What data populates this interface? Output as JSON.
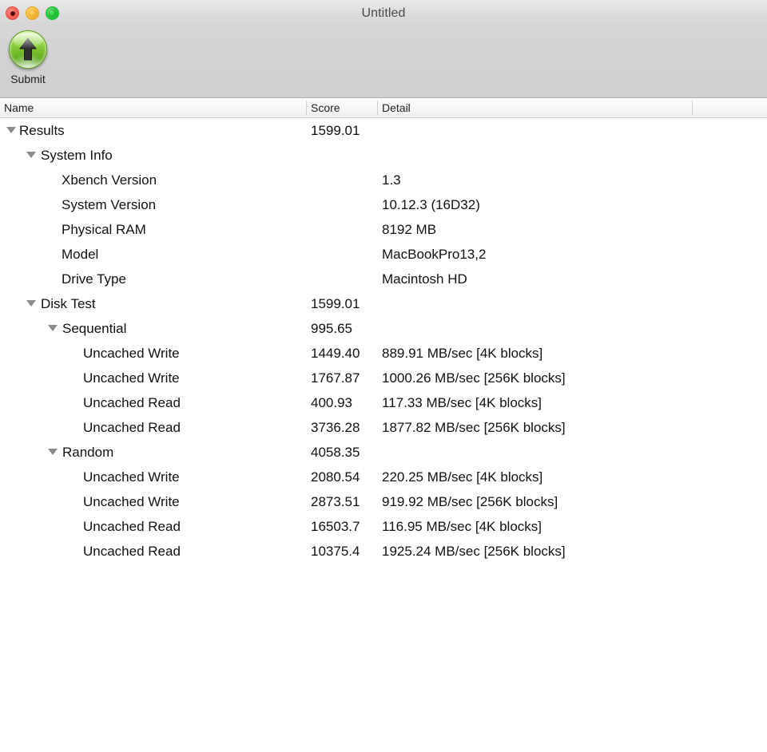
{
  "window": {
    "title": "Untitled",
    "traffic_lights": [
      "close",
      "minimize",
      "zoom"
    ]
  },
  "toolbar": {
    "submit_label": "Submit",
    "submit_icon": "green-up-arrow-orb-icon"
  },
  "columns": {
    "name": "Name",
    "score": "Score",
    "detail": "Detail"
  },
  "rows": [
    {
      "level": 0,
      "expandable": true,
      "name": "Results",
      "score": "1599.01",
      "detail": ""
    },
    {
      "level": 1,
      "expandable": true,
      "name": "System Info",
      "score": "",
      "detail": ""
    },
    {
      "level": 2,
      "expandable": false,
      "name": "Xbench Version",
      "score": "",
      "detail": "1.3"
    },
    {
      "level": 2,
      "expandable": false,
      "name": "System Version",
      "score": "",
      "detail": "10.12.3 (16D32)"
    },
    {
      "level": 2,
      "expandable": false,
      "name": "Physical RAM",
      "score": "",
      "detail": "8192 MB"
    },
    {
      "level": 2,
      "expandable": false,
      "name": "Model",
      "score": "",
      "detail": "MacBookPro13,2"
    },
    {
      "level": 2,
      "expandable": false,
      "name": "Drive Type",
      "score": "",
      "detail": "Macintosh HD"
    },
    {
      "level": 1,
      "expandable": true,
      "name": "Disk Test",
      "score": "1599.01",
      "detail": ""
    },
    {
      "level": 2,
      "expandable": true,
      "name": "Sequential",
      "score": "995.65",
      "detail": ""
    },
    {
      "level": 3,
      "expandable": false,
      "name": "Uncached Write",
      "score": "1449.40",
      "detail": "889.91 MB/sec [4K blocks]"
    },
    {
      "level": 3,
      "expandable": false,
      "name": "Uncached Write",
      "score": "1767.87",
      "detail": "1000.26 MB/sec [256K blocks]"
    },
    {
      "level": 3,
      "expandable": false,
      "name": "Uncached Read",
      "score": "400.93",
      "detail": "117.33 MB/sec [4K blocks]"
    },
    {
      "level": 3,
      "expandable": false,
      "name": "Uncached Read",
      "score": "3736.28",
      "detail": "1877.82 MB/sec [256K blocks]"
    },
    {
      "level": 2,
      "expandable": true,
      "name": "Random",
      "score": "4058.35",
      "detail": ""
    },
    {
      "level": 3,
      "expandable": false,
      "name": "Uncached Write",
      "score": "2080.54",
      "detail": "220.25 MB/sec [4K blocks]"
    },
    {
      "level": 3,
      "expandable": false,
      "name": "Uncached Write",
      "score": "2873.51",
      "detail": "919.92 MB/sec [256K blocks]"
    },
    {
      "level": 3,
      "expandable": false,
      "name": "Uncached Read",
      "score": "16503.7",
      "detail": "116.95 MB/sec [4K blocks]"
    },
    {
      "level": 3,
      "expandable": false,
      "name": "Uncached Read",
      "score": "10375.4",
      "detail": "1925.24 MB/sec [256K blocks]"
    }
  ]
}
